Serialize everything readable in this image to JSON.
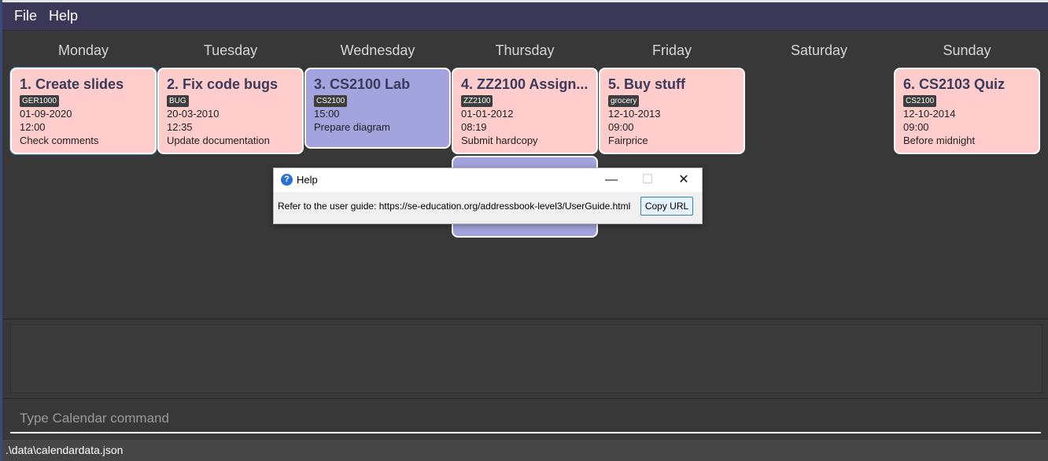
{
  "menu": {
    "file": "File",
    "help": "Help"
  },
  "days": [
    "Monday",
    "Tuesday",
    "Wednesday",
    "Thursday",
    "Friday",
    "Saturday",
    "Sunday"
  ],
  "events": [
    {
      "title": "1.  Create slides",
      "tag": "GER1000",
      "date": "01-09-2020",
      "time": "12:00",
      "desc": "Check comments",
      "color": "#ffcccc"
    },
    {
      "title": "2.  Fix code bugs",
      "tag": "BUG",
      "date": "20-03-2010",
      "time": "12:35",
      "desc": "Update documentation",
      "color": "#ffcccc"
    },
    {
      "title": "3.  CS2100 Lab",
      "tag": "CS2100",
      "time": "15:00",
      "desc": "Prepare diagram",
      "color": "#a3a3dd"
    },
    {
      "title": "4.  ZZ2100 Assign...",
      "tag": "ZZ2100",
      "date": "01-01-2012",
      "time": "08:19",
      "desc": "Submit hardcopy",
      "color": "#ffcccc"
    },
    {
      "title": "5.  Buy stuff",
      "tag": "grocery",
      "date": "12-10-2013",
      "time": "09:00",
      "desc": "Fairprice",
      "color": "#ffcccc"
    },
    {
      "title": "6.  CS2103 Quiz",
      "tag": "CS2100",
      "date": "12-10-2014",
      "time": "09:00",
      "desc": "Before midnight",
      "color": "#ffcccc"
    }
  ],
  "command": {
    "placeholder": "Type Calendar command",
    "value": ""
  },
  "status": {
    "path": ".\\data\\calendardata.json"
  },
  "help_dialog": {
    "title": "Help",
    "message": "Refer to the user guide: https://se-education.org/addressbook-level3/UserGuide.html",
    "copy_label": "Copy URL",
    "icon": "question-icon",
    "minimize_glyph": "—",
    "maximize_glyph": "☐",
    "close_glyph": "✕"
  }
}
